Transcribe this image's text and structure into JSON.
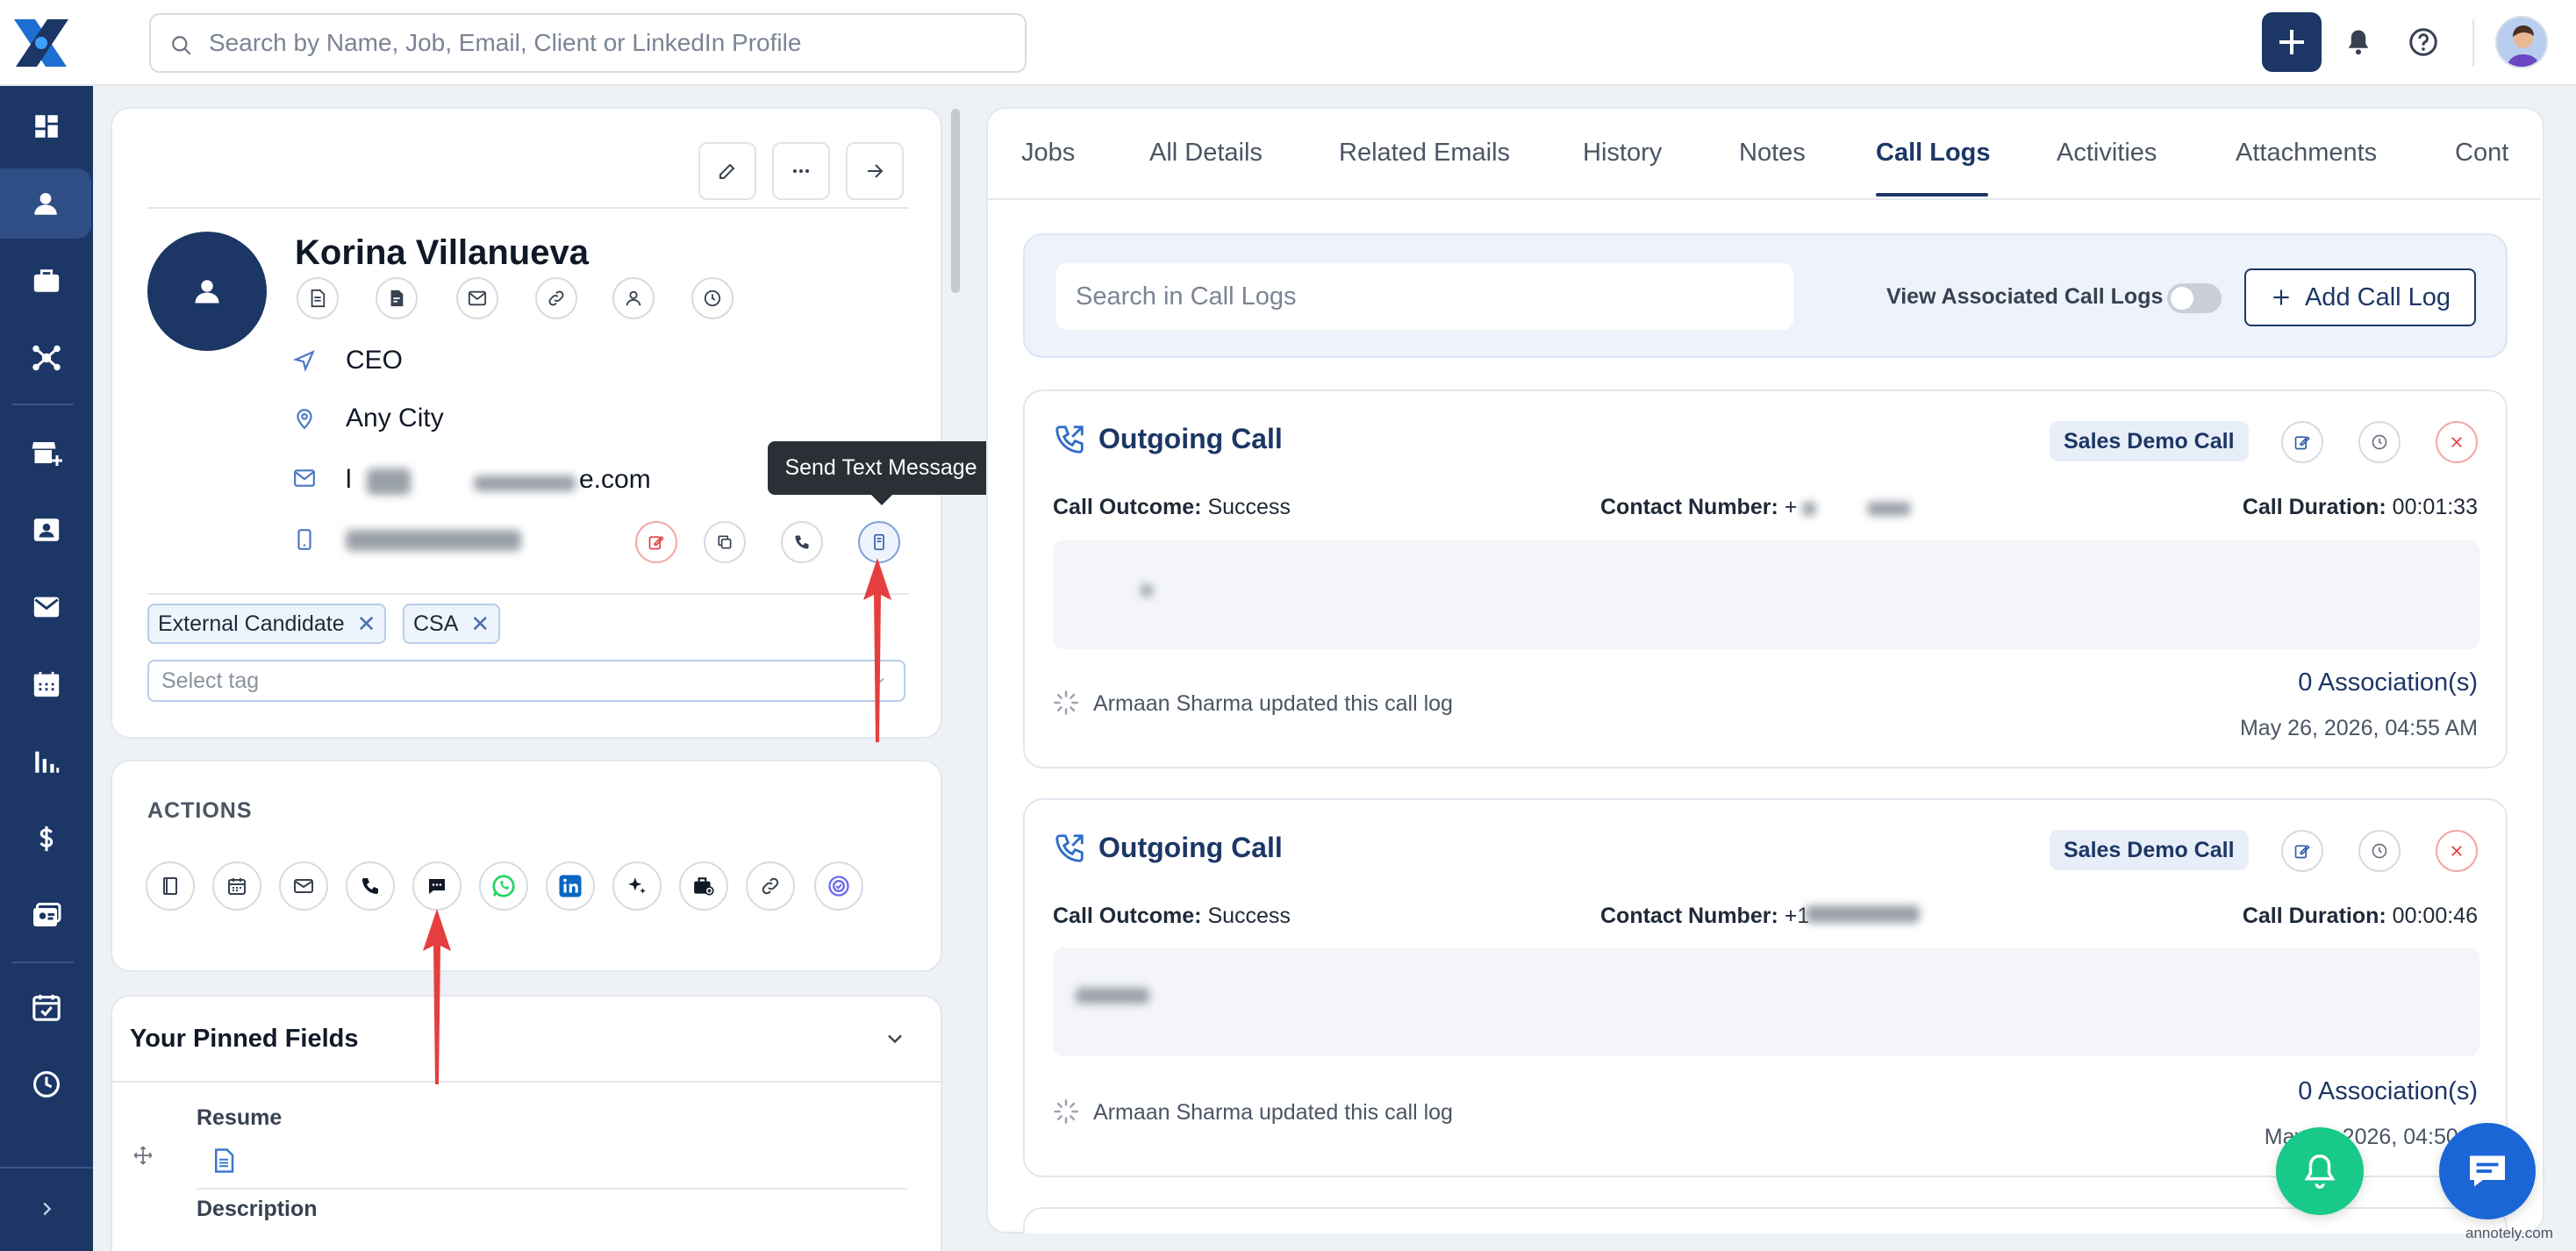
{
  "search": {
    "placeholder": "Search by Name, Job, Email, Client or LinkedIn Profile"
  },
  "profile": {
    "name": "Korina Villanueva",
    "title": "CEO",
    "location": "Any City",
    "email_prefix": "l",
    "email_suffix": "e.com",
    "tags": [
      "External Candidate",
      "CSA"
    ],
    "tag_placeholder": "Select tag",
    "tooltip": "Send Text Message"
  },
  "actions": {
    "heading": "ACTIONS"
  },
  "pinned": {
    "heading": "Your Pinned Fields",
    "field1": "Resume",
    "field2": "Description"
  },
  "tabs": [
    "Jobs",
    "All Details",
    "Related Emails",
    "History",
    "Notes",
    "Call Logs",
    "Activities",
    "Attachments",
    "Cont"
  ],
  "call_logs": {
    "search_placeholder": "Search in Call Logs",
    "toggle_label": "View Associated Call Logs",
    "add_button": "Add Call Log",
    "entries": [
      {
        "title": "Outgoing Call",
        "badge": "Sales Demo Call",
        "outcome_label": "Call Outcome:",
        "outcome": "Success",
        "contact_label": "Contact Number:",
        "contact": "+",
        "duration_label": "Call Duration:",
        "duration": "00:01:33",
        "updater": "Armaan Sharma updated this call log",
        "associations": "0 Association(s)",
        "timestamp": "May 26, 2026, 04:55 AM"
      },
      {
        "title": "Outgoing Call",
        "badge": "Sales Demo Call",
        "outcome_label": "Call Outcome:",
        "outcome": "Success",
        "contact_label": "Contact Number:",
        "contact": "+1",
        "duration_label": "Call Duration:",
        "duration": "00:00:46",
        "updater": "Armaan Sharma updated this call log",
        "associations": "0 Association(s)",
        "timestamp": "May 2 , 2026, 04:50 A"
      }
    ]
  },
  "watermark": "annotely.com",
  "colors": {
    "primary": "#1c3766",
    "accent_red": "#e53e3e",
    "whatsapp": "#25d366",
    "linkedin": "#0a66c2",
    "fab_green": "#18c98a",
    "chat_blue": "#1a66d6"
  }
}
